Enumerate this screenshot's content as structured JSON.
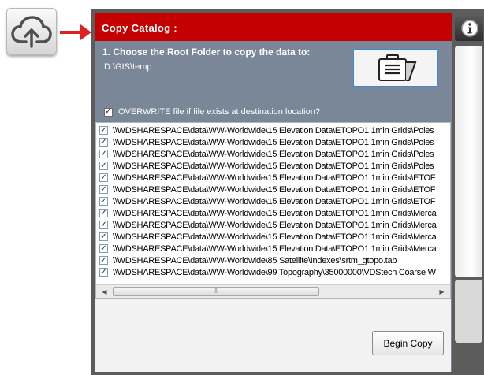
{
  "icons": {
    "launcher": "cloud-upload-icon",
    "arrow": "red-arrow-icon",
    "browse": "briefcase-icon",
    "info": "info-icon"
  },
  "colors": {
    "title_bar": "#c40000",
    "dialog_bg": "#7a8799",
    "frame": "#5c5c5c",
    "arrow": "#e02020"
  },
  "dialog": {
    "title": "Copy Catalog :",
    "step_label": "1. Choose the Root Folder to copy the data to:",
    "root_folder_path": "D:\\GIS\\temp",
    "overwrite": {
      "checked": true,
      "label": "OVERWRITE file if file exists at destination location?"
    },
    "files": [
      {
        "checked": true,
        "path": "\\\\WDSHARESPACE\\data\\WW-Worldwide\\15 Elevation Data\\ETOPO1 1min Grids\\Poles"
      },
      {
        "checked": true,
        "path": "\\\\WDSHARESPACE\\data\\WW-Worldwide\\15 Elevation Data\\ETOPO1 1min Grids\\Poles"
      },
      {
        "checked": true,
        "path": "\\\\WDSHARESPACE\\data\\WW-Worldwide\\15 Elevation Data\\ETOPO1 1min Grids\\Poles"
      },
      {
        "checked": true,
        "path": "\\\\WDSHARESPACE\\data\\WW-Worldwide\\15 Elevation Data\\ETOPO1 1min Grids\\Poles"
      },
      {
        "checked": true,
        "path": "\\\\WDSHARESPACE\\data\\WW-Worldwide\\15 Elevation Data\\ETOPO1 1min Grids\\ETOF"
      },
      {
        "checked": true,
        "path": "\\\\WDSHARESPACE\\data\\WW-Worldwide\\15 Elevation Data\\ETOPO1 1min Grids\\ETOF"
      },
      {
        "checked": true,
        "path": "\\\\WDSHARESPACE\\data\\WW-Worldwide\\15 Elevation Data\\ETOPO1 1min Grids\\ETOF"
      },
      {
        "checked": true,
        "path": "\\\\WDSHARESPACE\\data\\WW-Worldwide\\15 Elevation Data\\ETOPO1 1min Grids\\Merca"
      },
      {
        "checked": true,
        "path": "\\\\WDSHARESPACE\\data\\WW-Worldwide\\15 Elevation Data\\ETOPO1 1min Grids\\Merca"
      },
      {
        "checked": true,
        "path": "\\\\WDSHARESPACE\\data\\WW-Worldwide\\15 Elevation Data\\ETOPO1 1min Grids\\Merca"
      },
      {
        "checked": true,
        "path": "\\\\WDSHARESPACE\\data\\WW-Worldwide\\15 Elevation Data\\ETOPO1 1min Grids\\Merca"
      },
      {
        "checked": true,
        "path": "\\\\WDSHARESPACE\\data\\WW-Worldwide\\85 Satellite\\Indexes\\srtm_gtopo.tab"
      },
      {
        "checked": true,
        "path": "\\\\WDSHARESPACE\\data\\WW-Worldwide\\99 Topography\\35000000\\VDStech Coarse W"
      }
    ],
    "scroll_grip": "III",
    "begin_copy_label": "Begin Copy"
  }
}
